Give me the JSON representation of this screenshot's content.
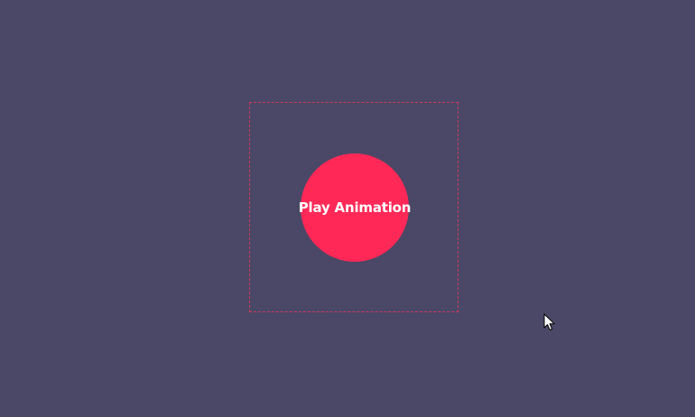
{
  "page": {
    "background_color": "#4a4866"
  },
  "animation_area": {
    "border_color": "#d2385f"
  },
  "play_button": {
    "label": "Play Animation",
    "color": "#ff2857",
    "text_color": "#ffffff"
  },
  "cursor": {
    "icon": "mouse-pointer-icon"
  }
}
